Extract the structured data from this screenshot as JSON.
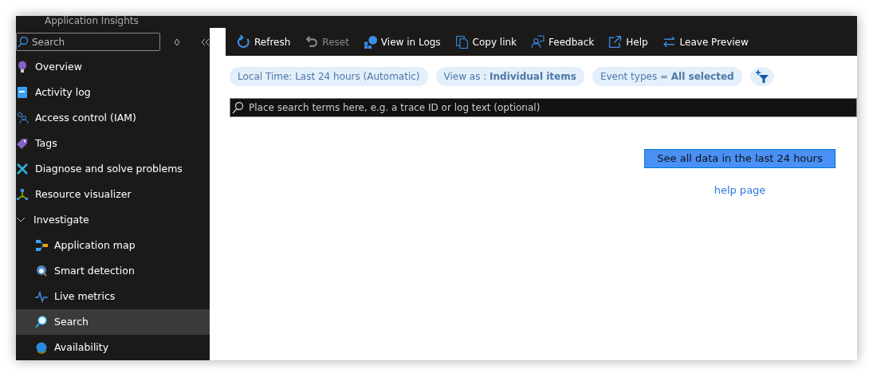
{
  "header": {
    "title": "Application Insights"
  },
  "sidebar": {
    "search": {
      "placeholder": "Search"
    },
    "items": [
      {
        "label": "Overview",
        "selected": false
      },
      {
        "label": "Activity log",
        "selected": false
      },
      {
        "label": "Access control (IAM)",
        "selected": false
      },
      {
        "label": "Tags",
        "selected": false
      },
      {
        "label": "Diagnose and solve problems",
        "selected": false
      },
      {
        "label": "Resource visualizer",
        "selected": false
      },
      {
        "label": "Investigate",
        "selected": false,
        "expanded": true,
        "children": [
          {
            "label": "Application map",
            "selected": false
          },
          {
            "label": "Smart detection",
            "selected": false
          },
          {
            "label": "Live metrics",
            "selected": false
          },
          {
            "label": "Search",
            "selected": true
          },
          {
            "label": "Availability",
            "selected": false
          }
        ]
      }
    ]
  },
  "toolbar": [
    {
      "label": "Refresh",
      "disabled": false
    },
    {
      "label": "Reset",
      "disabled": true
    },
    {
      "label": "View in Logs",
      "disabled": false
    },
    {
      "label": "Copy link",
      "disabled": false
    },
    {
      "label": "Feedback",
      "disabled": false
    },
    {
      "label": "Help",
      "disabled": false
    },
    {
      "label": "Leave Preview",
      "disabled": false
    }
  ],
  "filters": [
    {
      "text": "Local Time: Last 24 hours (Automatic)"
    },
    {
      "text": "View as :  **Individual items**"
    },
    {
      "text": "Event types = **All selected**"
    }
  ],
  "query": {
    "placeholder": "Place search terms here, e.g. a trace ID or log text (optional)"
  },
  "see_all_button": "See all data in the last 24 hours",
  "help_link": "help page"
}
